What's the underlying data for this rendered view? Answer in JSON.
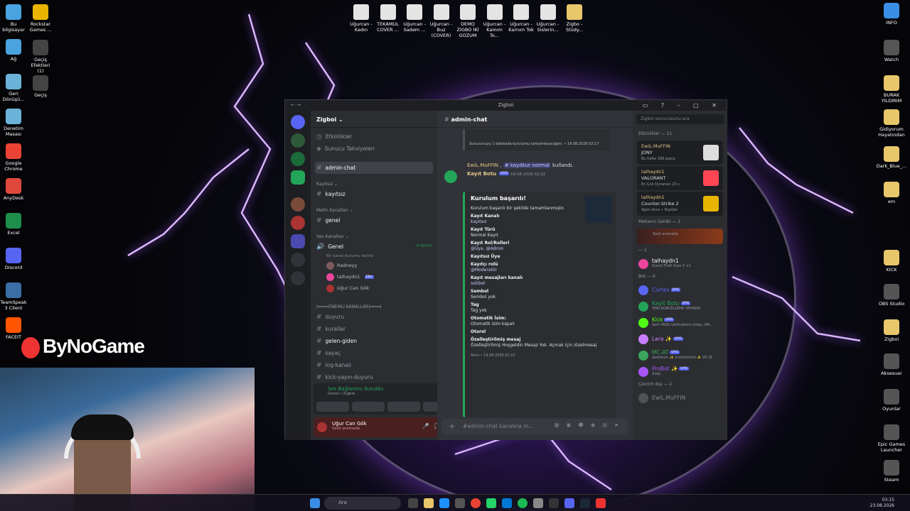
{
  "desktop": {
    "left_icons": [
      {
        "label": "Bu bilgisayar",
        "icon": "computer-icon"
      },
      {
        "label": "Ağ",
        "icon": "network-icon"
      },
      {
        "label": "Geri Dönüşü...",
        "icon": "recycle-bin-icon"
      },
      {
        "label": "Denetim Masası",
        "icon": "control-panel-icon"
      },
      {
        "label": "Google Chrome",
        "icon": "chrome-icon"
      },
      {
        "label": "AnyDesk",
        "icon": "anydesk-icon"
      },
      {
        "label": "Excel",
        "icon": "excel-icon"
      },
      {
        "label": "Discord",
        "icon": "discord-icon"
      },
      {
        "label": "TeamSpeak 3 Client",
        "icon": "teamspeak-icon"
      },
      {
        "label": "FACEIT",
        "icon": "faceit-icon"
      }
    ],
    "second_col_icons": [
      {
        "label": "Rockstar Games ...",
        "icon": "rockstar-icon"
      },
      {
        "label": "Geçiş Efektleri (1)",
        "icon": "video-icon"
      },
      {
        "label": "Geçiş",
        "icon": "video-icon"
      }
    ],
    "top_icons": [
      {
        "label": "Uğurcan - Kadın",
        "icon": "media-file-icon"
      },
      {
        "label": "TEKAMUL COVER ...",
        "icon": "media-file-icon"
      },
      {
        "label": "Uğurcan - Sadem ...",
        "icon": "media-file-icon"
      },
      {
        "label": "Uğurcan - Buz (COVER)",
        "icon": "media-file-icon"
      },
      {
        "label": "DEMO ZIGBO İKİ GOZUM",
        "icon": "media-file-icon"
      },
      {
        "label": "Uğurcan - Kamım To...",
        "icon": "media-file-icon"
      },
      {
        "label": "Uğurcan - Karnım Tok",
        "icon": "media-file-icon"
      },
      {
        "label": "Uğurcan - Sislerin...",
        "icon": "media-file-icon"
      },
      {
        "label": "Zigbo - Stüdy...",
        "icon": "folder-icon"
      }
    ],
    "right_icons": [
      {
        "label": "INFO",
        "icon": "info-icon"
      },
      {
        "label": "Watch",
        "icon": "watch-icon"
      },
      {
        "label": "BURAK YILDIRIM",
        "icon": "folder-icon"
      },
      {
        "label": "Gidiyorum Hayatından",
        "icon": "folder-icon"
      },
      {
        "label": "Dark_Blue_...",
        "icon": "folder-icon"
      },
      {
        "label": "em",
        "icon": "folder-icon"
      },
      {
        "label": "KICK",
        "icon": "folder-icon"
      },
      {
        "label": "OBS Studio",
        "icon": "obs-icon"
      },
      {
        "label": "Zigboi",
        "icon": "folder-icon"
      },
      {
        "label": "Aksesuar",
        "icon": "gear-icon"
      },
      {
        "label": "Oyunlar",
        "icon": "close-x-icon"
      },
      {
        "label": "Epic Games Launcher",
        "icon": "epic-icon"
      },
      {
        "label": "Steam",
        "icon": "steam-icon"
      }
    ],
    "brand": "ByNoGame"
  },
  "taskbar": {
    "search_placeholder": "Ara",
    "time": "03:15",
    "date": "23.08.2026"
  },
  "discord": {
    "window_title": "Zigboi",
    "server_name": "Zigboi",
    "top_links": [
      "Etkinlikler",
      "Sunucu Takviyeleri"
    ],
    "selected_channel": "admin-chat",
    "categories": [
      {
        "name": "Kayıtsız",
        "channels": [
          "kayıtsız"
        ]
      },
      {
        "name": "Metin Kanalları",
        "channels": [
          "genel"
        ]
      },
      {
        "name": "Ses Kanalları",
        "channels": []
      }
    ],
    "voice_channel": {
      "name": "Genel",
      "timer": "0:30:03",
      "status": "Bir kanal durumu belirle",
      "users": [
        "Radneyy",
        "talhaydn1",
        "Uğur Can Gök"
      ],
      "live_tag": "EBV"
    },
    "important_category": "|━━━━ÖNEMLİ KANALLAR|━━━━|",
    "important_channels": [
      "duyuru",
      "kurallar",
      "gelen-giden",
      "sayaç",
      "log-kanalı",
      "kick-yayın-duyuru"
    ],
    "voice_connected": {
      "title": "Ses Bağlantısı Kuruldu",
      "sub": "Genel / Zigboi"
    },
    "user": {
      "name": "Uğur Can Gök",
      "status": "Sesli aramada"
    },
    "chat": {
      "top_snippet": "Sunucunuzu 1 dakikada kurulumu tamamlayacağım. • 19.08.2026 02:17",
      "used_line_user": "EwiL.MuFFIN",
      "used_line_cmd": "kayıtkur normal",
      "used_line_tail": "kullandı.",
      "bot_name": "Kayıt Botu",
      "bot_tag": "UYG",
      "bot_time": "19.08.2026 02:22",
      "embed": {
        "title": "Kurulum başarılı!",
        "desc": "Kurulum başarılı bir şekilde tamamlanmıştır.",
        "fields": [
          {
            "k": "Kayıt Kanalı",
            "v": "kayıtsız"
          },
          {
            "k": "Kayıt Türü",
            "v": "Normal Kayıt"
          },
          {
            "k": "Kayıt Rol/Rolleri",
            "v": "@Üye, @Admin"
          },
          {
            "k": "Kayıtsız Üye",
            "v": ""
          },
          {
            "k": "Kayıtçı rolü",
            "v": "@Moderatör"
          },
          {
            "k": "Kayıt mesajları kanalı",
            "v": "sohbet"
          },
          {
            "k": "Sembol",
            "v": "Sembol yok"
          },
          {
            "k": "Tag",
            "v": "Tag yok"
          },
          {
            "k": "Otomatik İsim:",
            "v": "Otomatik isim kapalı"
          },
          {
            "k": "Otorol",
            "v": ""
          },
          {
            "k": "Özelleştirilmiş mesaj",
            "v": "Özelleştirilmiş Hoşgeldin Mesajı Yok. Açmak için /özelmesaj"
          }
        ],
        "footer": "Nora • 19.08.2026 02:22"
      },
      "input_placeholder": "#admin-chat kanalına m..."
    },
    "members": {
      "search_placeholder": "Zigboi sunucusunu ara",
      "activities_header": "Etkinlikler — 11",
      "activities": [
        {
          "user": "EwiL.MuFFIN",
          "game": "JONY",
          "sub": "Bu hafta 188 parça"
        },
        {
          "user": "talhaydn1",
          "game": "VALORANT",
          "sub": "En Çok Oynanan 23 s"
        },
        {
          "user": "talhaydn1",
          "game": "Counter-Strike 2",
          "sub": "4gün önce • Popüler"
        }
      ],
      "owner_header": "Mekanın Sahibi — 1",
      "owner_status": "Sesli aramada",
      "group_header": "— 1",
      "group_member": {
        "name": "talhaydn1",
        "sub": "Grand Theft Auto V +1"
      },
      "bot_header": "Bot — 6",
      "bots": [
        {
          "name": "Cortex",
          "sub": "",
          "color": "#5865f2"
        },
        {
          "name": "Kayıt Botu",
          "sub": "YENİ GÜNCELLEME YAYINDA!",
          "color": "#23a55a"
        },
        {
          "name": "Kick",
          "sub": "Sent 4656 notifications today. (46...",
          "color": "#53fc18"
        },
        {
          "name": "Lara ✨",
          "sub": "",
          "color": "#c77dff"
        },
        {
          "name": "MC-AT",
          "sub": "/premium ✨ /customhost ✨ V6.18",
          "color": "#3ba55c"
        },
        {
          "name": "ProBot ✨",
          "sub": "/help",
          "color": "#a855f7"
        }
      ],
      "offline_header": "Çevrim dışı — 2",
      "offline_member": "EwiL.MuFFIN"
    }
  }
}
